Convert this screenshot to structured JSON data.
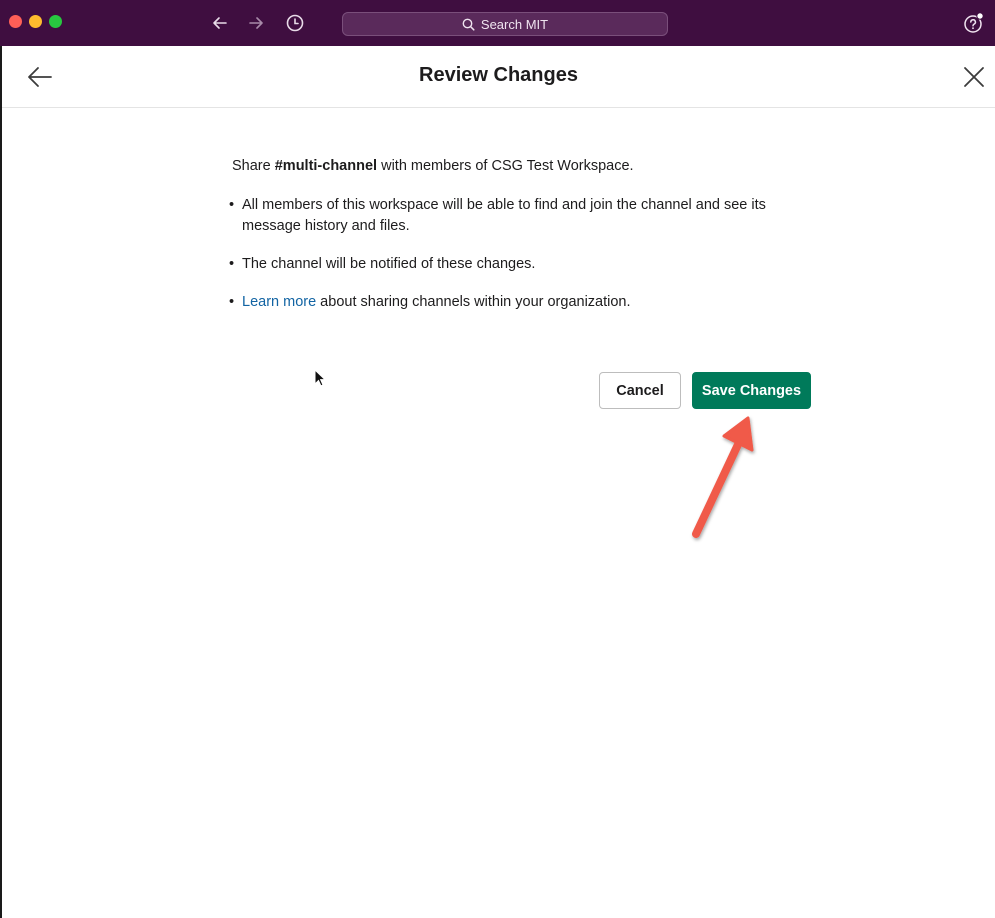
{
  "window": {
    "search_placeholder": "Search MIT",
    "colors": {
      "titlebar": "#3f0e40",
      "accent": "#007a5a",
      "link": "#1264a3"
    }
  },
  "header": {
    "title": "Review Changes",
    "back_icon": "arrow-left-icon",
    "close_icon": "close-icon"
  },
  "content": {
    "intro_prefix": "Share ",
    "channel_name": "#multi-channel",
    "intro_suffix": " with members of CSG Test Workspace.",
    "bullets": [
      "All members of this workspace will be able to find and join the channel and see its message history and files.",
      "The channel will be notified of these changes.",
      {
        "link": "Learn more",
        "text": " about sharing channels within your organization."
      }
    ]
  },
  "actions": {
    "cancel_label": "Cancel",
    "save_label": "Save Changes"
  }
}
